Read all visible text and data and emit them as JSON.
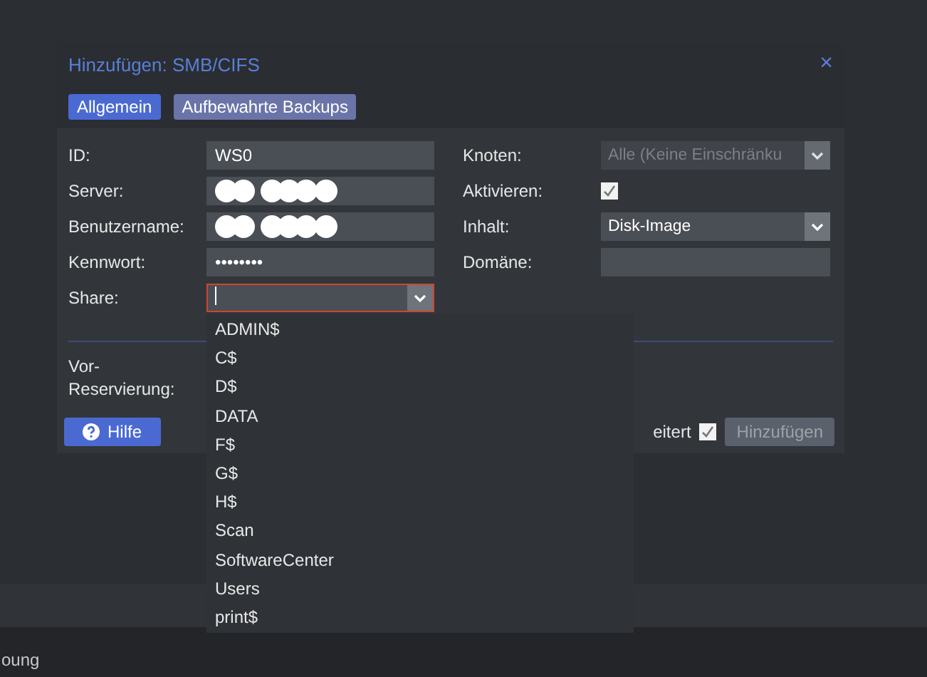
{
  "dialog": {
    "title": "Hinzufügen: SMB/CIFS",
    "close": "×"
  },
  "tabs": [
    {
      "label": "Allgemein",
      "selected": true
    },
    {
      "label": "Aufbewahrte Backups",
      "selected": false
    }
  ],
  "left_fields": [
    {
      "label": "ID:",
      "kind": "text",
      "value": "WS0"
    },
    {
      "label": "Server:",
      "kind": "redacted"
    },
    {
      "label": "Benutzername:",
      "kind": "redacted"
    },
    {
      "label": "Kennwort:",
      "kind": "text",
      "value": "••••••••"
    },
    {
      "label": "Share:",
      "kind": "combo",
      "invalid": true
    }
  ],
  "right_fields": [
    {
      "label": "Knoten:",
      "kind": "combo",
      "placeholder": "Alle (Keine Einschränku",
      "disabled": true
    },
    {
      "label": "Aktivieren:",
      "kind": "checkbox",
      "checked": true
    },
    {
      "label": "Inhalt:",
      "kind": "combo",
      "value": "Disk-Image",
      "disabled": false
    },
    {
      "label": "Domäne:",
      "kind": "text"
    }
  ],
  "advanced_label": "Vor-Reservierung:",
  "footer": {
    "help": "Hilfe",
    "advanced": "eitert",
    "advanced_checked": true,
    "add": "Hinzufügen",
    "add_disabled": true
  },
  "share_options": [
    "ADMIN$",
    "C$",
    "D$",
    "DATA",
    "F$",
    "G$",
    "H$",
    "Scan",
    "SoftwareCenter",
    "Users",
    "print$"
  ],
  "background_text": "oung"
}
